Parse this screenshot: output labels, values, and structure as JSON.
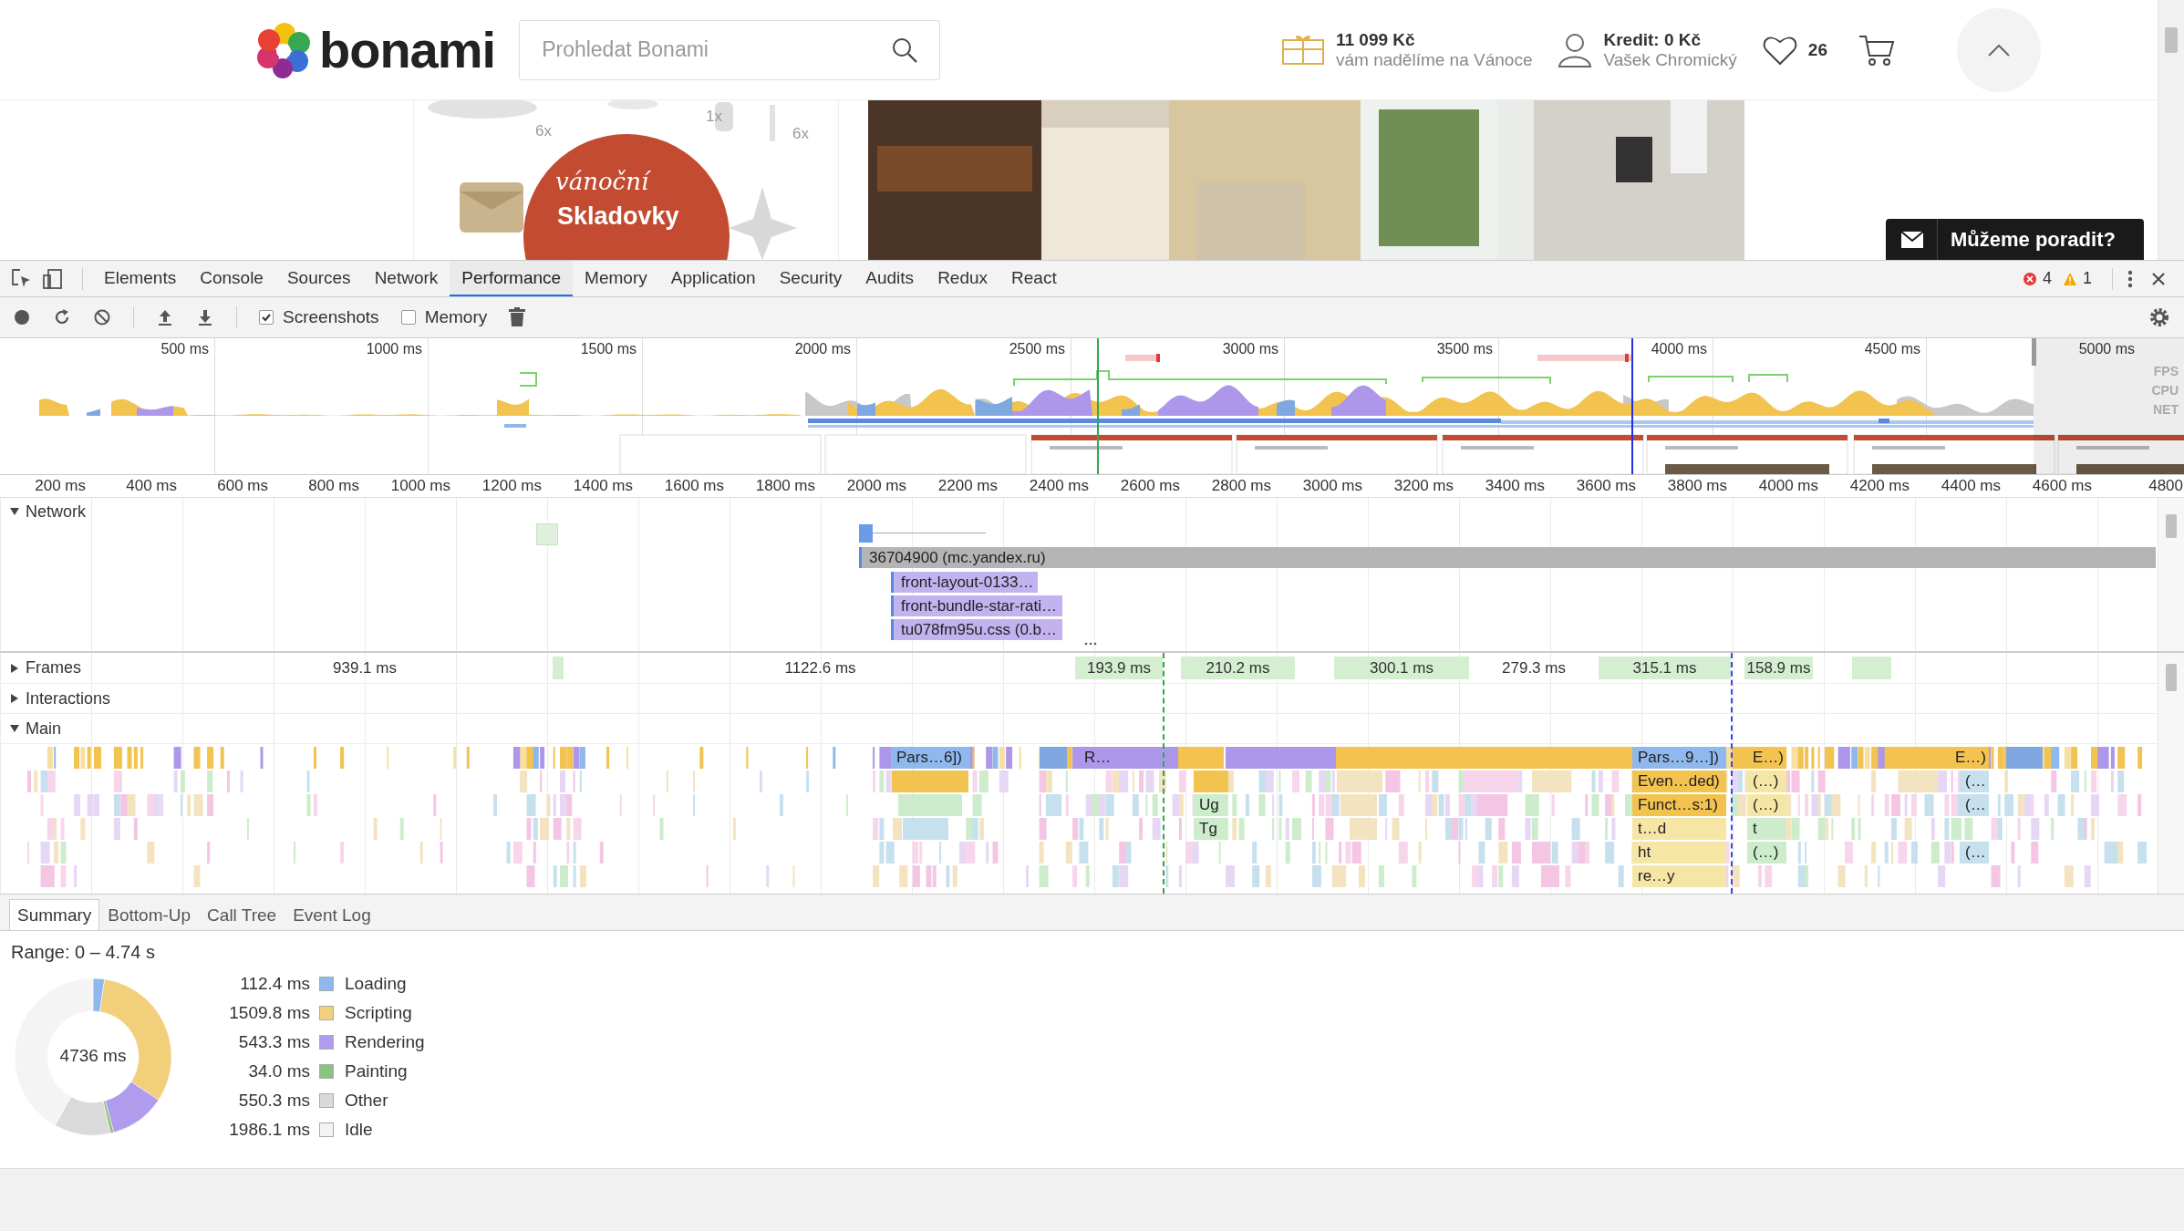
{
  "site_header": {
    "brand": "bonami",
    "search": {
      "placeholder": "Prohledat Bonami"
    },
    "gift": {
      "amount": "11 099 Kč",
      "caption": "vám nadělíme na Vánoce"
    },
    "account": {
      "credit": "Kredit: 0 Kč",
      "name": "Vašek Chromický"
    },
    "favorites_count": "26"
  },
  "banner": {
    "quantities": [
      "6x",
      "1x",
      "6x"
    ],
    "promo_script": "vánoční",
    "promo_title": "Skladovky",
    "chat_button": "Můžeme poradit?"
  },
  "devtools": {
    "tabs": [
      {
        "label": "Elements",
        "selected": false
      },
      {
        "label": "Console",
        "selected": false
      },
      {
        "label": "Sources",
        "selected": false
      },
      {
        "label": "Network",
        "selected": false
      },
      {
        "label": "Performance",
        "selected": true
      },
      {
        "label": "Memory",
        "selected": false
      },
      {
        "label": "Application",
        "selected": false
      },
      {
        "label": "Security",
        "selected": false
      },
      {
        "label": "Audits",
        "selected": false
      },
      {
        "label": "Redux",
        "selected": false
      },
      {
        "label": "React",
        "selected": false
      }
    ],
    "errors": "4",
    "warnings": "1",
    "toolbar": {
      "checkboxes": [
        {
          "label": "Screenshots",
          "checked": true
        },
        {
          "label": "Memory",
          "checked": false
        }
      ]
    }
  },
  "overview": {
    "ticks": [
      "500 ms",
      "1000 ms",
      "1500 ms",
      "2000 ms",
      "2500 ms",
      "3000 ms",
      "3500 ms",
      "4000 ms",
      "4500 ms",
      "5000 ms"
    ],
    "tracks": [
      "FPS",
      "CPU",
      "NET"
    ]
  },
  "ruler": [
    "200 ms",
    "400 ms",
    "600 ms",
    "800 ms",
    "1000 ms",
    "1200 ms",
    "1400 ms",
    "1600 ms",
    "1800 ms",
    "2000 ms",
    "2200 ms",
    "2400 ms",
    "2600 ms",
    "2800 ms",
    "3000 ms",
    "3200 ms",
    "3400 ms",
    "3600 ms",
    "3800 ms",
    "4000 ms",
    "4200 ms",
    "4400 ms",
    "4600 ms",
    "4800"
  ],
  "network": {
    "label": "Network",
    "expanded": true,
    "requests": [
      {
        "label": "36704900 (mc.yandex.ru)",
        "kind": "other"
      },
      {
        "label": "front-layout-0133…",
        "kind": "stylesheet"
      },
      {
        "label": "front-bundle-star-rati…",
        "kind": "stylesheet"
      },
      {
        "label": "tu078fm95u.css (0.b…",
        "kind": "stylesheet"
      }
    ]
  },
  "tracks": [
    {
      "label": "Frames",
      "expanded": false
    },
    {
      "label": "Interactions",
      "expanded": false
    },
    {
      "label": "Main",
      "expanded": true
    }
  ],
  "frames": [
    {
      "label": "939.1 ms",
      "kind": "idle"
    },
    {
      "label": "1122.6 ms",
      "kind": "idle"
    },
    {
      "label": "193.9 ms",
      "kind": "drawn"
    },
    {
      "label": "210.2 ms",
      "kind": "drawn"
    },
    {
      "label": "300.1 ms",
      "kind": "drawn"
    },
    {
      "label": "279.3 ms",
      "kind": "idle"
    },
    {
      "label": "315.1 ms",
      "kind": "drawn"
    },
    {
      "label": "158.9 ms",
      "kind": "drawn"
    }
  ],
  "main_rows": [
    [
      {
        "label": "Pars…6])",
        "kind": "loading"
      },
      {
        "label": "R…",
        "kind": "rendering"
      },
      {
        "label": "Pars…9…])",
        "kind": "loading"
      },
      {
        "label": "E…)",
        "kind": "scripting"
      },
      {
        "label": "E…)",
        "kind": "scripting"
      }
    ],
    [
      {
        "label": "Even…ded)",
        "kind": "scripting"
      },
      {
        "label": "(…)",
        "kind": "function"
      },
      {
        "label": "(…",
        "kind": "compile"
      }
    ],
    [
      {
        "label": "Ug",
        "kind": "library"
      },
      {
        "label": "Funct…s:1)",
        "kind": "scripting"
      },
      {
        "label": "(…)",
        "kind": "function"
      },
      {
        "label": "(…",
        "kind": "compile"
      }
    ],
    [
      {
        "label": "Tg",
        "kind": "library"
      },
      {
        "label": "t…d",
        "kind": "function"
      },
      {
        "label": "t",
        "kind": "library"
      }
    ],
    [
      {
        "label": "ht",
        "kind": "function"
      },
      {
        "label": "(…)",
        "kind": "library"
      },
      {
        "label": "(…",
        "kind": "compile"
      }
    ],
    [
      {
        "label": "re…y",
        "kind": "function"
      }
    ]
  ],
  "summary": {
    "tabs": [
      {
        "label": "Summary",
        "selected": true
      },
      {
        "label": "Bottom-Up",
        "selected": false
      },
      {
        "label": "Call Tree",
        "selected": false
      },
      {
        "label": "Event Log",
        "selected": false
      }
    ],
    "range": "Range: 0 – 4.74 s",
    "total": "4736 ms",
    "legend": [
      {
        "value": "112.4 ms",
        "color": "#8fb8ed"
      },
      {
        "value": "1509.8 ms",
        "color": "#f2cf7b"
      },
      {
        "value": "543.3 ms",
        "color": "#af9ced"
      },
      {
        "value": "34.0 ms",
        "color": "#8dc17f"
      },
      {
        "value": "550.3 ms",
        "color": "#dadada"
      },
      {
        "value": "1986.1 ms",
        "color": "#f4f4f4"
      }
    ],
    "chart_data": {
      "type": "donut",
      "categories": [
        "Loading",
        "Scripting",
        "Rendering",
        "Painting",
        "Other",
        "Idle"
      ],
      "values": [
        2.37,
        31.88,
        11.47,
        0.72,
        11.62,
        41.94
      ]
    }
  }
}
